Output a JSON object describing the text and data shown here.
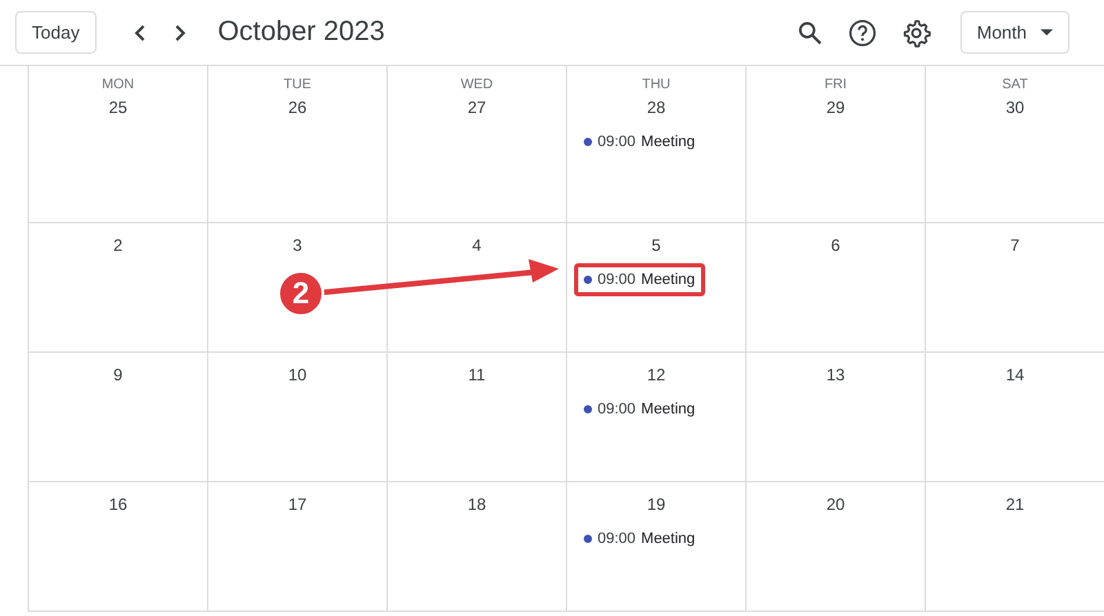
{
  "toolbar": {
    "today_button": "Today",
    "title": "October 2023",
    "view_button": "Month"
  },
  "weeks": [
    {
      "days": [
        {
          "weekday": "MON",
          "date": "25"
        },
        {
          "weekday": "TUE",
          "date": "26"
        },
        {
          "weekday": "WED",
          "date": "27"
        },
        {
          "weekday": "THU",
          "date": "28",
          "events": [
            {
              "time": "09:00",
              "title": "Meeting",
              "color": "#3f51b5",
              "highlighted": false
            }
          ]
        },
        {
          "weekday": "FRI",
          "date": "29"
        },
        {
          "weekday": "SAT",
          "date": "30"
        }
      ]
    },
    {
      "days": [
        {
          "date": "2"
        },
        {
          "date": "3"
        },
        {
          "date": "4"
        },
        {
          "date": "5",
          "events": [
            {
              "time": "09:00",
              "title": "Meeting",
              "color": "#3f51b5",
              "highlighted": true
            }
          ]
        },
        {
          "date": "6"
        },
        {
          "date": "7"
        }
      ]
    },
    {
      "days": [
        {
          "date": "9"
        },
        {
          "date": "10"
        },
        {
          "date": "11"
        },
        {
          "date": "12",
          "events": [
            {
              "time": "09:00",
              "title": "Meeting",
              "color": "#3f51b5",
              "highlighted": false
            }
          ]
        },
        {
          "date": "13"
        },
        {
          "date": "14"
        }
      ]
    },
    {
      "days": [
        {
          "date": "16"
        },
        {
          "date": "17"
        },
        {
          "date": "18"
        },
        {
          "date": "19",
          "events": [
            {
              "time": "09:00",
              "title": "Meeting",
              "color": "#3f51b5",
              "highlighted": false
            }
          ]
        },
        {
          "date": "20"
        },
        {
          "date": "21"
        }
      ]
    }
  ],
  "annotation": {
    "label": "2"
  }
}
